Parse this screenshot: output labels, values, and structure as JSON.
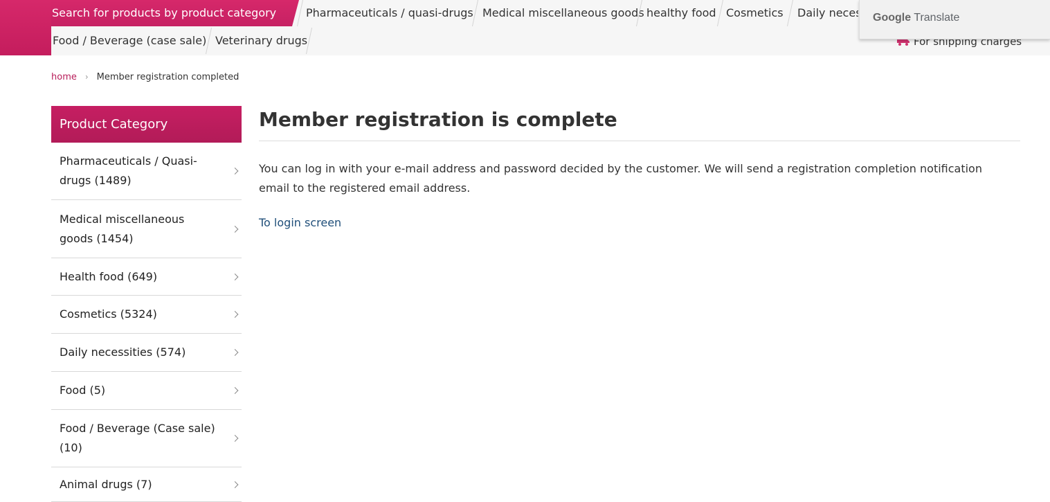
{
  "top_nav": {
    "search_label": "Search for products by product category",
    "row1": [
      "Pharmaceuticals / quasi-drugs",
      "Medical miscellaneous goods",
      "healthy food",
      "Cosmetics",
      "Daily necess"
    ],
    "row2": [
      "Food / Beverage (case sale)",
      "Veterinary drugs"
    ],
    "shipping_label": "For shipping charges"
  },
  "translate_popup": {
    "google": "Google",
    "translate": "Translate"
  },
  "breadcrumb": {
    "home": "home",
    "current": "Member registration completed"
  },
  "sidebar": {
    "title": "Product Category",
    "items": [
      {
        "label": "Pharmaceuticals / Quasi-drugs (1489)"
      },
      {
        "label": "Medical miscellaneous goods (1454)"
      },
      {
        "label": "Health food (649)"
      },
      {
        "label": "Cosmetics (5324)"
      },
      {
        "label": "Daily necessities (574)"
      },
      {
        "label": "Food (5)"
      },
      {
        "label": "Food / Beverage (Case sale) (10)"
      },
      {
        "label": "Animal drugs (7)"
      }
    ]
  },
  "main": {
    "title": "Member registration is complete",
    "description": "You can log in with your e-mail address and password decided by the customer. We will send a registration completion notification email to the registered email address.",
    "login_link": "To login screen"
  },
  "colors": {
    "brand_pink": "#c61f62",
    "link_pink": "#b81d5a",
    "link_blue": "#1f4e79"
  }
}
